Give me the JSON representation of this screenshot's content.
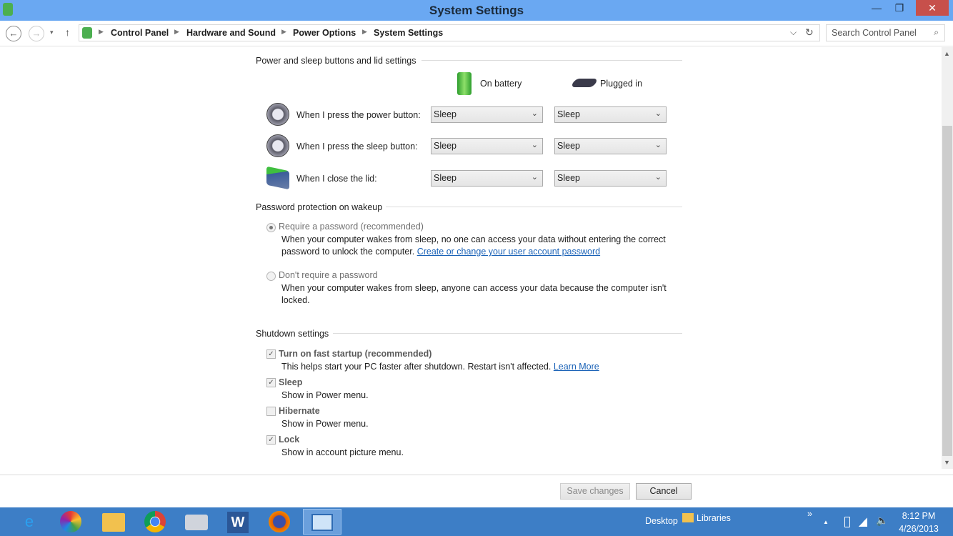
{
  "window": {
    "title": "System Settings",
    "minimize": "—",
    "restore": "❐",
    "close": "✕"
  },
  "nav": {
    "back": "←",
    "forward": "→",
    "recent": "▾",
    "up": "↑",
    "dropdown": "⌵",
    "refresh": "↻"
  },
  "breadcrumb": [
    "Control Panel",
    "Hardware and Sound",
    "Power Options",
    "System Settings"
  ],
  "search": {
    "placeholder": "Search Control Panel",
    "icon": "search-icon"
  },
  "power": {
    "heading": "Power and sleep buttons and lid settings",
    "col_battery": "On battery",
    "col_plugged": "Plugged in",
    "rows": [
      {
        "label": "When I press the power button:",
        "battery": "Sleep",
        "plugged": "Sleep",
        "icon": "power-button-icon"
      },
      {
        "label": "When I press the sleep button:",
        "battery": "Sleep",
        "plugged": "Sleep",
        "icon": "sleep-button-icon"
      },
      {
        "label": "When I close the lid:",
        "battery": "Sleep",
        "plugged": "Sleep",
        "icon": "laptop-lid-icon"
      }
    ]
  },
  "password": {
    "heading": "Password protection on wakeup",
    "require_label": "Require a password (recommended)",
    "require_selected": true,
    "require_desc1": "When your computer wakes from sleep, no one can access your data without entering the correct",
    "require_desc2": "password to unlock the computer.",
    "require_link": "Create or change your user account password",
    "norequire_label": "Don't require a password",
    "norequire_desc1": "When your computer wakes from sleep, anyone can access your data because the computer isn't",
    "norequire_desc2": "locked."
  },
  "shutdown": {
    "heading": "Shutdown settings",
    "items": [
      {
        "label": "Turn on fast startup (recommended)",
        "desc": "This helps start your PC faster after shutdown. Restart isn't affected.",
        "link": "Learn More",
        "checked": true
      },
      {
        "label": "Sleep",
        "desc": "Show in Power menu.",
        "checked": true
      },
      {
        "label": "Hibernate",
        "desc": "Show in Power menu.",
        "checked": false
      },
      {
        "label": "Lock",
        "desc": "Show in account picture menu.",
        "checked": true
      }
    ]
  },
  "footer": {
    "save": "Save changes",
    "cancel": "Cancel"
  },
  "taskbar": {
    "apps": [
      "internet-explorer",
      "picasa",
      "file-explorer",
      "chrome",
      "fax-scanner",
      "word",
      "firefox",
      "control-panel"
    ],
    "desktop": "Desktop",
    "libraries": "Libraries",
    "chevron": "»",
    "tray_up": "▲",
    "time": "8:12 PM",
    "date": "4/26/2013"
  },
  "colors": {
    "titlebar": "#6aa8f2",
    "taskbar": "#3d7ec6",
    "link": "#1a62b7",
    "close": "#c7504b"
  }
}
